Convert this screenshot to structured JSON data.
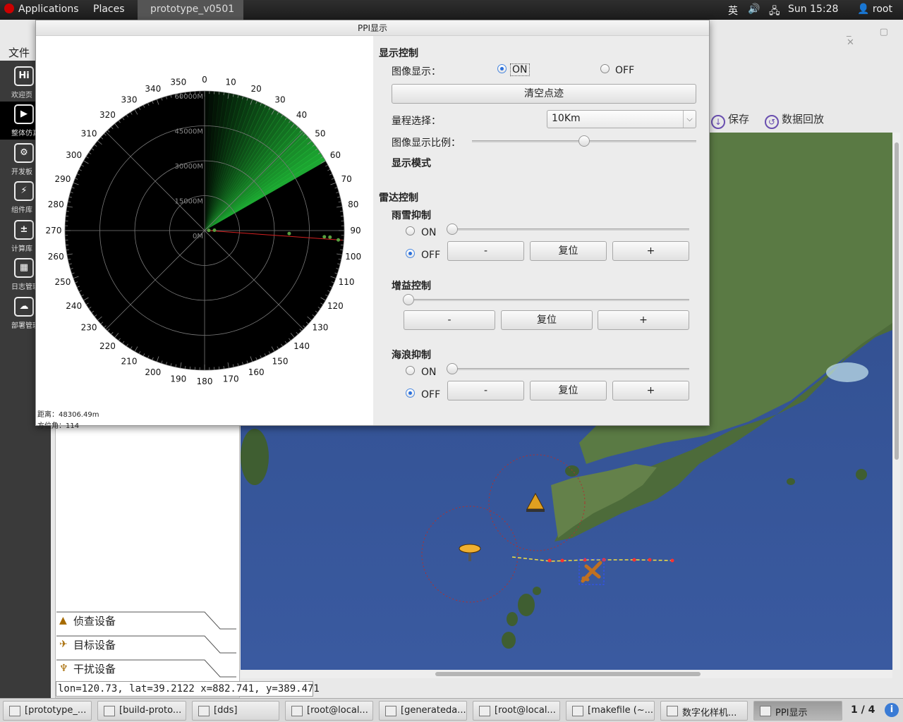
{
  "top_panel": {
    "applications": "Applications",
    "places": "Places",
    "window_task": "prototype_v0501",
    "lang": "英",
    "clock": "Sun 15:28",
    "user": "root"
  },
  "main_app": {
    "menu_file": "文件",
    "rail": [
      {
        "icon": "hi-icon",
        "glyph": "Hi",
        "label": "欢迎页"
      },
      {
        "icon": "play-icon",
        "glyph": "▶",
        "label": "整体仿真"
      },
      {
        "icon": "dev-board-icon",
        "glyph": "⚙",
        "label": "开发板"
      },
      {
        "icon": "bolt-icon",
        "glyph": "⚡",
        "label": "组件库"
      },
      {
        "icon": "calculator-icon",
        "glyph": "±",
        "label": "计算库"
      },
      {
        "icon": "calendar-icon",
        "glyph": "▦",
        "label": "日志管理"
      },
      {
        "icon": "cloud-icon",
        "glyph": "☁",
        "label": "部署管理"
      }
    ],
    "categories": [
      {
        "label": "侦查设备",
        "icon": "radar-device-icon"
      },
      {
        "label": "目标设备",
        "icon": "aircraft-icon"
      },
      {
        "label": "干扰设备",
        "icon": "jammer-icon"
      }
    ],
    "toolbar": {
      "save": "保存",
      "replay": "数据回放"
    },
    "status": "lon=120.73, lat=39.2122 x=882.741, y=389.471"
  },
  "ppi": {
    "title": "PPI显示",
    "readout": {
      "distance": "距离：48306.49m",
      "azimuth": "方位角：114"
    },
    "range_rings": [
      "0M",
      "15000M",
      "30000M",
      "45000M",
      "60000M"
    ],
    "bearings": [
      "0",
      "10",
      "20",
      "30",
      "40",
      "50",
      "60",
      "70",
      "80",
      "90",
      "100",
      "110",
      "120",
      "130",
      "140",
      "150",
      "160",
      "170",
      "180",
      "190",
      "200",
      "210",
      "220",
      "230",
      "240",
      "250",
      "260",
      "270",
      "280",
      "290",
      "300",
      "310",
      "320",
      "330",
      "340",
      "350"
    ],
    "sweep_angle_deg": 60
  },
  "controls": {
    "display_control": "显示控制",
    "image_display": "图像显示：",
    "on": "ON",
    "off": "OFF",
    "image_display_state": "ON",
    "clear_trace": "清空点迹",
    "range_select": "量程选择：",
    "range_value": "10Km",
    "display_scale": "图像显示比例：",
    "display_scale_level": 0.5,
    "display_mode": "显示模式",
    "radar_control": "雷达控制",
    "rain_snow": "雨雪抑制",
    "gain": "增益控制",
    "sea_wave": "海浪抑制",
    "rain_state": "OFF",
    "sea_state": "OFF",
    "minus": "-",
    "reset": "复位",
    "plus": "+"
  },
  "taskbar": {
    "tasks": [
      "[prototype_...",
      "[build-proto...",
      "[dds]",
      "[root@local...",
      "[generateda...",
      "[root@local...",
      "[makefile (~...",
      "数字化样机...",
      "PPI显示"
    ],
    "workspace": "1 / 4"
  },
  "colors": {
    "accent": "#2a6fdb",
    "sweep": "#22c33a",
    "track": "#d42020"
  }
}
